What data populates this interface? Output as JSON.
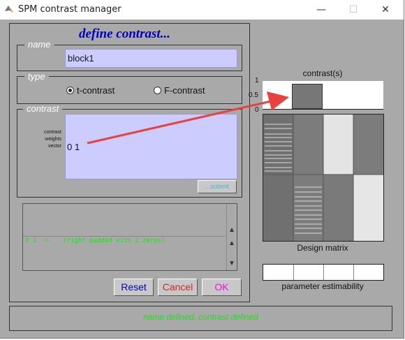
{
  "window": {
    "title": "SPM contrast manager",
    "minimize_glyph": "—",
    "maximize_glyph": "☐",
    "close_glyph": "✕"
  },
  "header": {
    "text": "define contrast..."
  },
  "name_group": {
    "label": "name",
    "value": "block1"
  },
  "type_group": {
    "label": "type",
    "options": [
      {
        "label": "t-contrast",
        "selected": true
      },
      {
        "label": "F-contrast",
        "selected": false
      }
    ]
  },
  "contrast_group": {
    "label": "contrast",
    "weights_label_lines": [
      "contrast",
      "weights",
      "vector"
    ],
    "value": "0 1",
    "submit_label": "...submit"
  },
  "messages": {
    "line": "0 1  <-   (right padded with 2 zeros)"
  },
  "buttons": {
    "reset": "Reset",
    "cancel": "Cancel",
    "ok": "OK"
  },
  "status": {
    "text": "name defined, contrast defined"
  },
  "contrast_plot": {
    "title": "contrast(s)",
    "y_ticks": [
      "1",
      "0.5",
      "0"
    ],
    "weights": [
      0,
      1,
      0,
      0
    ]
  },
  "design_matrix": {
    "label": "Design matrix"
  },
  "estimability": {
    "label": "parameter estimability",
    "cells": 4
  },
  "colors": {
    "window_bg": "#a9a9a9",
    "field_bg": "#ccccff",
    "header_text": "#0000cc",
    "reset_text": "#0000cc",
    "cancel_text": "#dd2222",
    "ok_text": "#ff00ff",
    "message_text": "#22dd22",
    "status_text": "#22dd22",
    "submit_text": "#22cccc",
    "arrow": "#e8413e"
  }
}
